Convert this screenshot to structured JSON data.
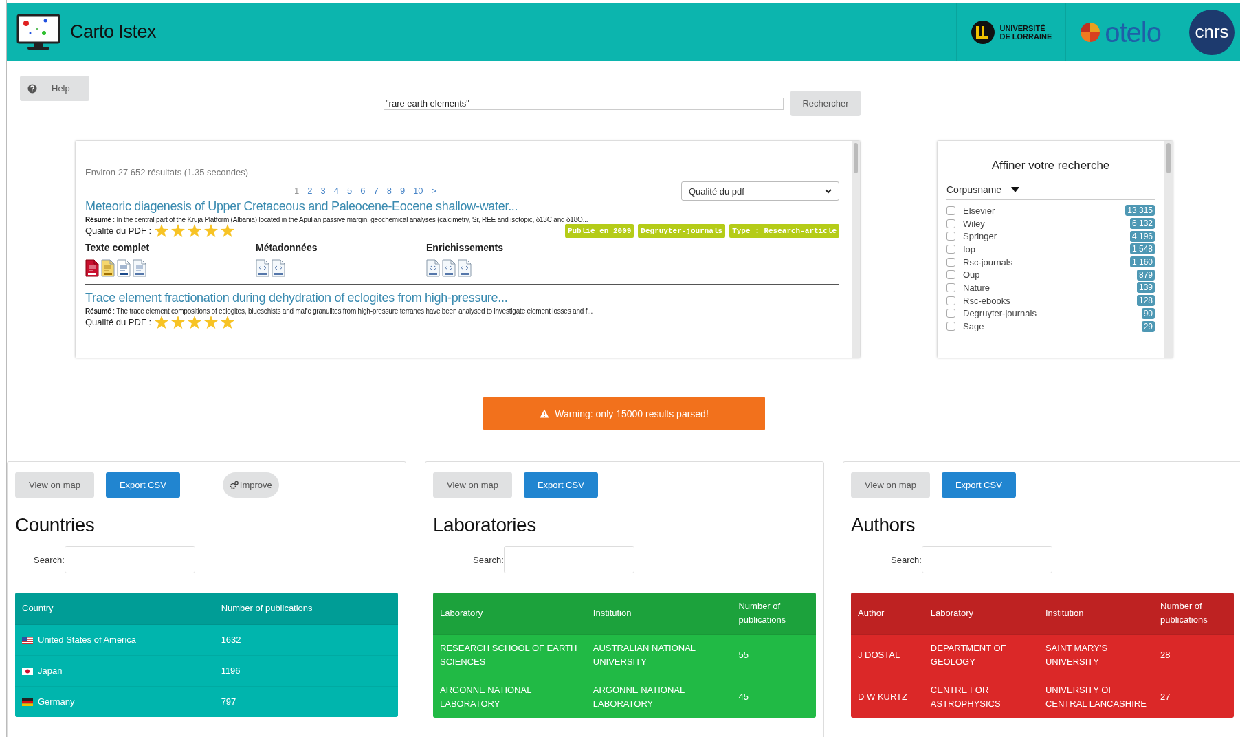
{
  "header": {
    "title": "Carto Istex",
    "partners": [
      {
        "kind": "lorraine",
        "text": "UNIVERSITÉ",
        "subtext": "DE LORRAINE"
      },
      {
        "kind": "otelo",
        "text": "otelo"
      },
      {
        "kind": "cnrs",
        "text": "cnrs"
      }
    ]
  },
  "help_button": {
    "label": "Help"
  },
  "search": {
    "value": "\"rare earth elements\"",
    "button": "Rechercher"
  },
  "results": {
    "summary": "Environ 27 652 résultats (1.35 secondes)",
    "pages": [
      {
        "label": "1",
        "selected": true
      },
      {
        "label": "2",
        "selected": false
      },
      {
        "label": "3",
        "selected": false
      },
      {
        "label": "4",
        "selected": false
      },
      {
        "label": "5",
        "selected": false
      },
      {
        "label": "6",
        "selected": false
      },
      {
        "label": "7",
        "selected": false
      },
      {
        "label": "8",
        "selected": false
      },
      {
        "label": "9",
        "selected": false
      },
      {
        "label": "10",
        "selected": false
      },
      {
        "label": ">",
        "selected": false
      }
    ],
    "sort": {
      "value": "Qualité du pdf"
    },
    "items": [
      {
        "title": "Meteoric diagenesis of Upper Cretaceous and Paleocene-Eocene shallow-water...",
        "abstract": "**Résumé** : In the central part of the Kruja Platform (Albania) located in the Apulian passive margin, geochemical analyses (calcimetry, Sr, REE and isotopic, δ13C and δ18O...",
        "quality_label": "Qualité du PDF :",
        "stars": 5,
        "tags": [
          "Publié en 2009",
          "Degruyter-journals",
          "Type : Research-article"
        ],
        "groups": [
          {
            "heading": "Texte complet",
            "files": [
              {
                "kind": "pdf"
              },
              {
                "kind": "zip"
              },
              {
                "kind": "tei"
              },
              {
                "kind": "txt"
              }
            ]
          },
          {
            "heading": "Métadonnées",
            "files": [
              {
                "kind": "xml"
              },
              {
                "kind": "mods"
              }
            ]
          },
          {
            "heading": "Enrichissements",
            "files": [
              {
                "kind": "xml"
              },
              {
                "kind": "xml"
              },
              {
                "kind": "xml"
              }
            ]
          }
        ]
      },
      {
        "title": "Trace element fractionation during dehydration of eclogites from high-pressure...",
        "abstract": "**Résumé** : The trace element compositions of eclogites, blueschists and mafic granulites from high-pressure terranes have been analysed to investigate element losses and f...",
        "quality_label": "Qualité du PDF :",
        "stars": 5
      }
    ]
  },
  "facets": {
    "title": "Affiner votre recherche",
    "field": "Corpusname",
    "items": [
      {
        "label": "Elsevier",
        "count": "13 315",
        "checked": false
      },
      {
        "label": "Wiley",
        "count": "6 132",
        "checked": false
      },
      {
        "label": "Springer",
        "count": "4 196",
        "checked": false
      },
      {
        "label": "Iop",
        "count": "1 548",
        "checked": false
      },
      {
        "label": "Rsc-journals",
        "count": "1 160",
        "checked": false
      },
      {
        "label": "Oup",
        "count": "879",
        "checked": false
      },
      {
        "label": "Nature",
        "count": "139",
        "checked": false
      },
      {
        "label": "Rsc-ebooks",
        "count": "128",
        "checked": false
      },
      {
        "label": "Degruyter-journals",
        "count": "90",
        "checked": false
      },
      {
        "label": "Sage",
        "count": "29",
        "checked": false
      }
    ]
  },
  "warning": {
    "text": "Warning: only 15000 results parsed!"
  },
  "panels": [
    {
      "title": "Countries",
      "color": "#00b5ad",
      "search_label": "Search:",
      "buttons": [
        {
          "kind": "plain",
          "label": "View on map"
        },
        {
          "kind": "primary",
          "label": "Export CSV"
        },
        {
          "kind": "round",
          "label": "Improve"
        }
      ],
      "columns": [
        "Country",
        "Number of publications"
      ],
      "rows": [
        {
          "kind": "us",
          "cells": [
            "United States of America",
            "1632"
          ]
        },
        {
          "kind": "jp",
          "cells": [
            "Japan",
            "1196"
          ]
        },
        {
          "kind": "de",
          "cells": [
            "Germany",
            "797"
          ]
        }
      ]
    },
    {
      "title": "Laboratories",
      "color": "#21ba45",
      "search_label": "Search:",
      "buttons": [
        {
          "kind": "plain",
          "label": "View on map"
        },
        {
          "kind": "primary",
          "label": "Export CSV"
        }
      ],
      "columns": [
        "Laboratory",
        "Institution",
        "Number of publications"
      ],
      "rows": [
        {
          "cells": [
            "RESEARCH SCHOOL OF EARTH SCIENCES",
            "AUSTRALIAN NATIONAL UNIVERSITY",
            "55"
          ]
        },
        {
          "cells": [
            "ARGONNE NATIONAL LABORATORY",
            "ARGONNE NATIONAL LABORATORY",
            "45"
          ]
        }
      ]
    },
    {
      "title": "Authors",
      "color": "#db2828",
      "search_label": "Search:",
      "buttons": [
        {
          "kind": "plain",
          "label": "View on map"
        },
        {
          "kind": "primary",
          "label": "Export CSV"
        }
      ],
      "columns": [
        "Author",
        "Laboratory",
        "Institution",
        "Number of publications"
      ],
      "rows": [
        {
          "cells": [
            "J DOSTAL",
            "DEPARTMENT OF GEOLOGY",
            "SAINT MARY'S UNIVERSITY",
            "28"
          ]
        },
        {
          "cells": [
            "D W KURTZ",
            "CENTRE FOR ASTROPHYSICS",
            "UNIVERSITY OF CENTRAL LANCASHIRE",
            "27"
          ]
        }
      ]
    }
  ]
}
